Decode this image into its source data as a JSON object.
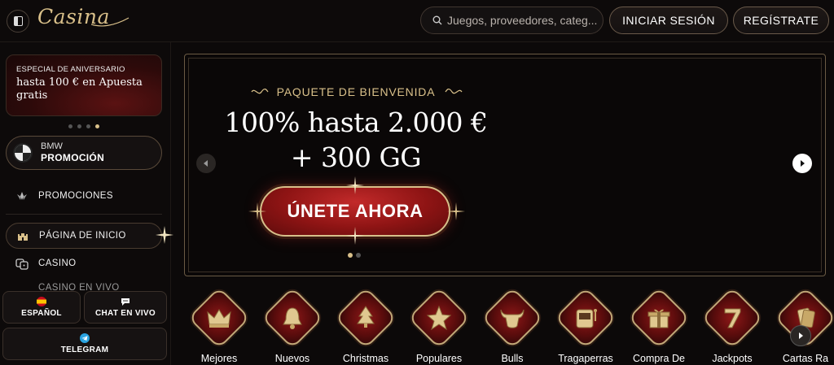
{
  "header": {
    "logo": "Casina",
    "search_placeholder": "Juegos, proveedores, categ...",
    "login_label": "INICIAR SESIÓN",
    "register_label": "REGÍSTRATE"
  },
  "sidebar": {
    "promo_card": {
      "kicker": "ESPECIAL DE ANIVERSARIO",
      "headline": "hasta 100 € en Apuesta gratis"
    },
    "promo_dots_count": 4,
    "promo_dots_active": 3,
    "bmw": {
      "line1": "BMW",
      "line2": "PROMOCIÓN"
    },
    "nav": {
      "promotions": "PROMOCIONES",
      "home": "PÁGINA DE INICIO",
      "casino": "CASINO",
      "live_casino": "CASINO EN VIVO"
    },
    "bottom": {
      "language": "ESPAÑOL",
      "live_chat": "CHAT EN VIVO",
      "telegram": "TELEGRAM"
    }
  },
  "hero": {
    "eyebrow": "PAQUETE DE BIENVENIDA",
    "title_line1": "100% hasta 2.000 €",
    "title_line2": "+ 300 GG",
    "cta_label": "ÚNETE AHORA",
    "slide_count": 2,
    "active_slide": 0
  },
  "categories": [
    {
      "label": "Mejores",
      "icon": "crown-icon"
    },
    {
      "label": "Nuevos",
      "icon": "bell-icon"
    },
    {
      "label": "Christmas",
      "icon": "christmas-tree-icon"
    },
    {
      "label": "Populares",
      "icon": "star-icon"
    },
    {
      "label": "Bulls",
      "icon": "bull-icon"
    },
    {
      "label": "Tragaperras",
      "icon": "slot-machine-icon"
    },
    {
      "label": "Compra De",
      "icon": "gift-icon"
    },
    {
      "label": "Jackpots",
      "icon": "seven-icon"
    },
    {
      "label": "Cartas Ra",
      "icon": "cards-icon"
    }
  ],
  "colors": {
    "gold": "#d9c08a",
    "red": "#8e1414",
    "background": "#0c0909"
  }
}
